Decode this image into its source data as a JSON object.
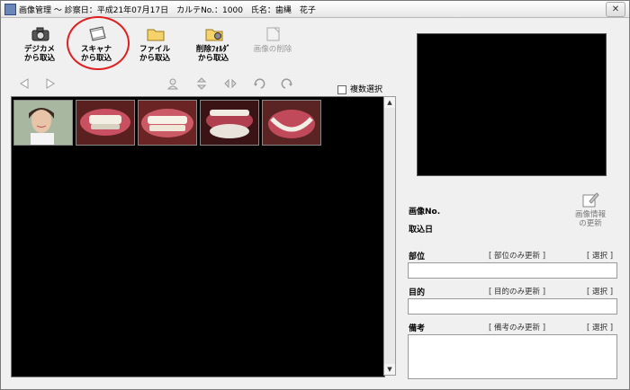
{
  "window": {
    "title": "画像管理 ～ 診察日：平成21年07月17日　カルテNo.：1000　氏名：歯縄　花子",
    "close_symbol": "✕"
  },
  "toolbar": {
    "camera_label": "デジカメ\nから取込",
    "scanner_label": "スキャナ\nから取込",
    "file_label": "ファイル\nから取込",
    "deleted_folder_label": "削除ﾌｫﾙﾀﾞ\nから取込",
    "delete_label": "画像の削除"
  },
  "multi_select_label": "複数選択",
  "thumbnails": [
    "portrait",
    "teeth-front",
    "teeth-smile",
    "mouth-open",
    "mouth-lower"
  ],
  "info": {
    "image_no_label": "画像No.",
    "import_date_label": "取込日",
    "update_info_label": "画像情報\nの更新",
    "site_label": "部位",
    "site_update_link": "[ 部位のみ更新 ]",
    "site_select_link": "[ 選択 ]",
    "purpose_label": "目的",
    "purpose_update_link": "[ 目的のみ更新 ]",
    "purpose_select_link": "[ 選択 ]",
    "notes_label": "備考",
    "notes_update_link": "[ 備考のみ更新 ]",
    "notes_select_link": "[ 選択 ]"
  },
  "scroll": {
    "up": "▲",
    "down": "▼"
  },
  "colors": {
    "highlight": "#e02020",
    "gallery_bg": "#000000"
  }
}
